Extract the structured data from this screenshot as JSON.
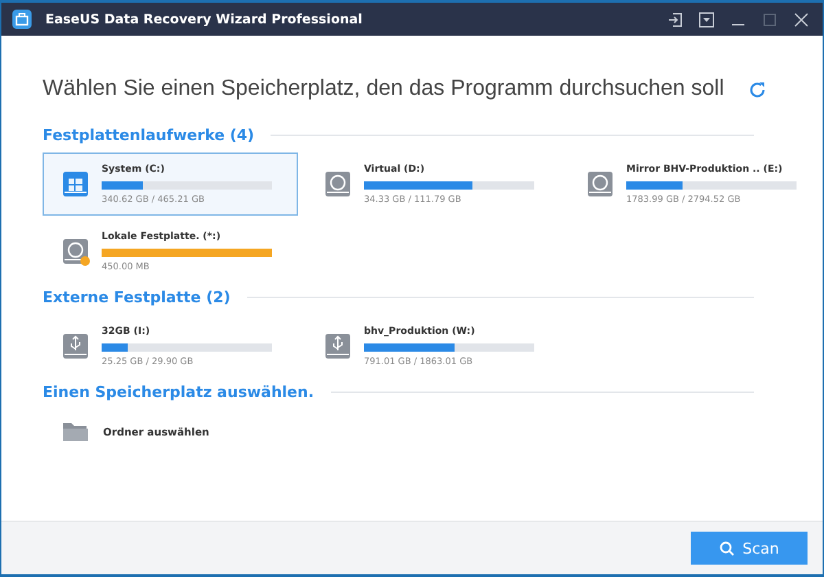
{
  "window": {
    "title": "EaseUS Data Recovery Wizard Professional"
  },
  "heading": "Wählen Sie einen Speicherplatz, den das Programm durchsuchen soll",
  "sections": [
    {
      "title": "Festplattenlaufwerke (4)",
      "drives": [
        {
          "kind": "system",
          "name": "System (C:)",
          "size": "340.62 GB / 465.21 GB",
          "level": 0.24,
          "color": "#2b8ae6",
          "selected": true
        },
        {
          "kind": "hdd",
          "name": "Virtual (D:)",
          "size": "34.33 GB / 111.79 GB",
          "level": 0.64,
          "color": "#2b8ae6",
          "selected": false
        },
        {
          "kind": "hdd",
          "name": "Mirror BHV-Produktion .. (E:)",
          "size": "1783.99 GB / 2794.52 GB",
          "level": 0.33,
          "color": "#2b8ae6",
          "selected": false
        },
        {
          "kind": "lost",
          "name": "Lokale Festplatte. (*:)",
          "size": "450.00 MB",
          "level": 1,
          "color": "#f5a623",
          "selected": false
        }
      ]
    },
    {
      "title": "Externe Festplatte (2)",
      "drives": [
        {
          "kind": "usb",
          "name": "32GB (I:)",
          "size": "25.25 GB / 29.90 GB",
          "level": 0.15,
          "color": "#2b8ae6",
          "selected": false
        },
        {
          "kind": "usb",
          "name": "bhv_Produktion (W:)",
          "size": "791.01 GB / 1863.01 GB",
          "level": 0.53,
          "color": "#2b8ae6",
          "selected": false
        }
      ]
    },
    {
      "title": "Einen Speicherplatz auswählen.",
      "folder": "Ordner auswählen"
    }
  ],
  "scan_button": "Scan"
}
